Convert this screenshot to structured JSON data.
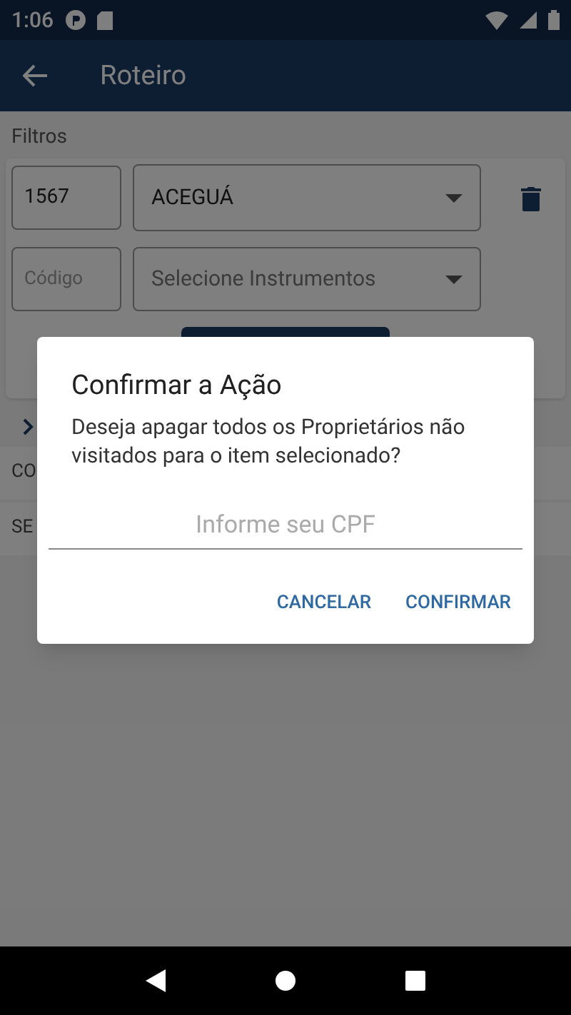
{
  "status_bar": {
    "time": "1:06"
  },
  "app_bar": {
    "title": "Roteiro"
  },
  "filters": {
    "title": "Filtros",
    "code_value": "1567",
    "city": "ACEGUÁ",
    "code_placeholder": "Código",
    "instrument_placeholder": "Selecione Instrumentos"
  },
  "list_rows": [
    "CO",
    "SE"
  ],
  "dialog": {
    "title": "Confirmar a Ação",
    "message": "Deseja apagar todos os Proprietários não visitados para o item selecionado?",
    "input": {
      "placeholder": "Informe seu CPF"
    },
    "buttons": [
      "CANCELAR",
      "CONFIRMAR"
    ]
  }
}
